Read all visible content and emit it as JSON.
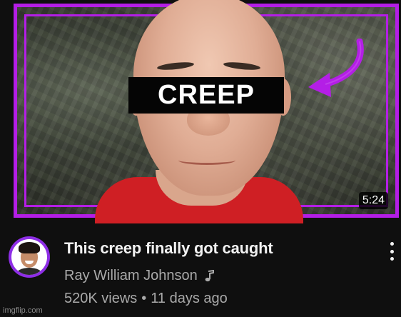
{
  "video": {
    "thumbnail_overlay_text": "CREEP",
    "duration": "5:24",
    "title": "This creep finally got caught",
    "channel": "Ray William Johnson",
    "views": "520K views",
    "separator": "•",
    "age": "11 days ago"
  },
  "icons": {
    "channel_badge": "music-note-icon",
    "menu": "more-vert-icon",
    "thumbnail_pointer": "curved-arrow-icon"
  },
  "colors": {
    "accent_border": "#b41ee6",
    "background": "#0f0f0f",
    "secondary_text": "#aaaaaa",
    "censor_bar": "#050505",
    "shirt": "#cf1f24"
  },
  "watermark": "imgflip.com"
}
